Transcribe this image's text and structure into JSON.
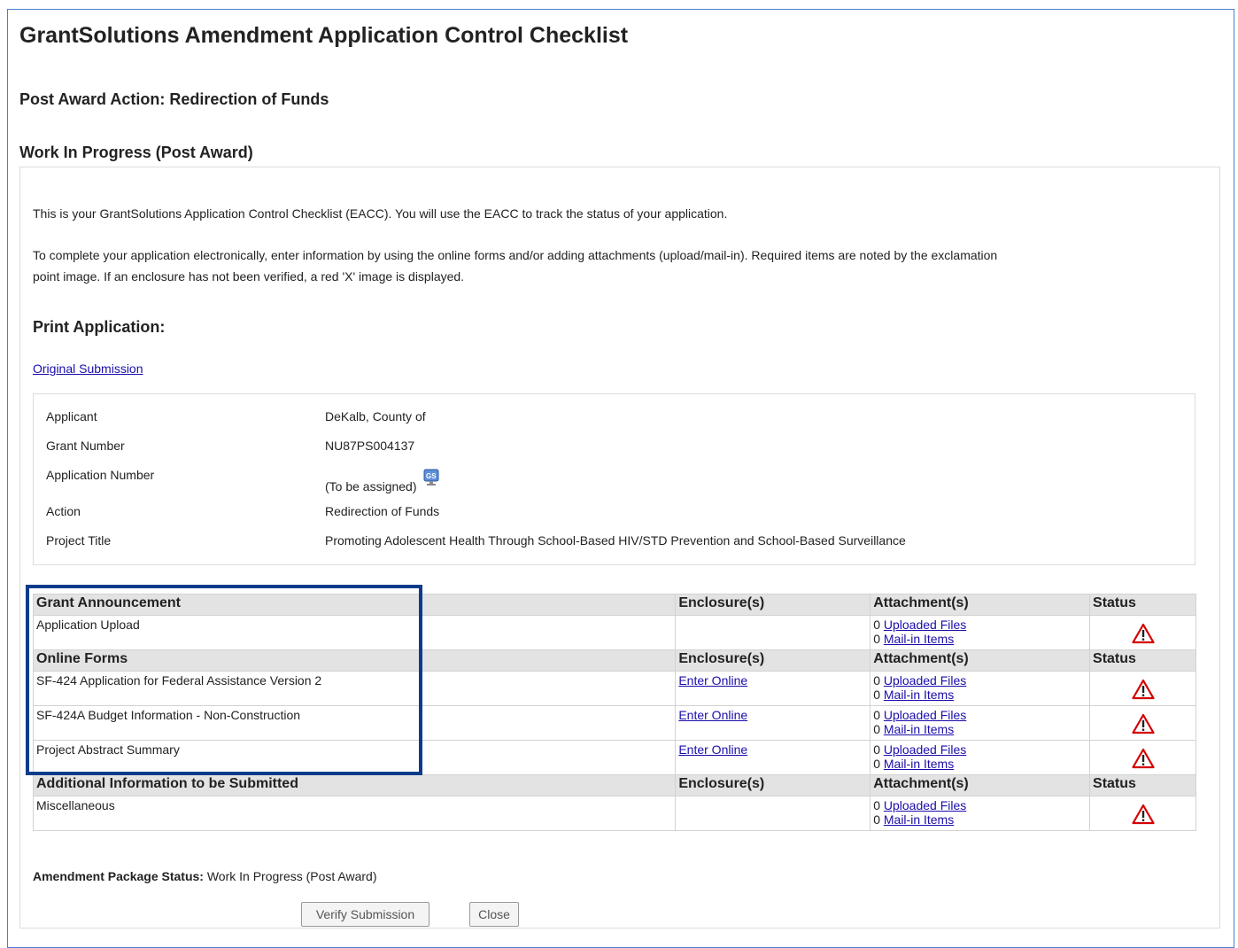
{
  "page": {
    "title": "GrantSolutions Amendment Application Control Checklist",
    "post_award_action": "Post Award Action: Redirection of Funds",
    "work_status_heading": "Work In Progress (Post Award)"
  },
  "intro": {
    "para1": "This is your GrantSolutions Application Control Checklist (EACC). You will use the EACC to track the status of your application.",
    "para2_line1": "To complete your application electronically, enter information by using the online forms and/or adding attachments (upload/mail-in).  Required items are noted by the exclamation",
    "para2_line2": "point image.  If an enclosure has not been verified, a red 'X' image is displayed."
  },
  "print": {
    "heading": "Print Application:",
    "original_submission_link": "Original Submission"
  },
  "info": {
    "applicant_label": "Applicant",
    "applicant_value": "DeKalb, County of",
    "grant_number_label": "Grant Number",
    "grant_number_value": "NU87PS004137",
    "application_number_label": "Application Number",
    "application_number_value": "(To be assigned)",
    "application_number_icon": "gs-icon",
    "action_label": "Action",
    "action_value": "Redirection of Funds",
    "project_title_label": "Project Title",
    "project_title_value": "Promoting Adolescent Health Through School-Based HIV/STD Prevention and School-Based Surveillance"
  },
  "checklist": {
    "enclosures_header": "Enclosure(s)",
    "attachments_header": "Attachment(s)",
    "status_header": "Status",
    "uploaded_label": "Uploaded Files",
    "mailin_label": "Mail-in Items",
    "status_icon": "warning-icon",
    "warning_color": "#d40000",
    "sections": [
      {
        "title": "Grant Announcement",
        "items": [
          {
            "name": "Application Upload",
            "enclosure": "",
            "uploaded_count": "0",
            "mailin_count": "0"
          }
        ]
      },
      {
        "title": "Online Forms",
        "items": [
          {
            "name": "SF-424 Application for Federal Assistance Version 2",
            "enclosure": "Enter Online",
            "uploaded_count": "0",
            "mailin_count": "0"
          },
          {
            "name": "SF-424A Budget Information - Non-Construction",
            "enclosure": "Enter Online",
            "uploaded_count": "0",
            "mailin_count": "0"
          },
          {
            "name": "Project Abstract Summary",
            "enclosure": "Enter Online",
            "uploaded_count": "0",
            "mailin_count": "0"
          }
        ]
      },
      {
        "title": "Additional Information to be Submitted",
        "items": [
          {
            "name": "Miscellaneous",
            "enclosure": "",
            "uploaded_count": "0",
            "mailin_count": "0"
          }
        ]
      }
    ]
  },
  "footer": {
    "package_status_label": "Amendment Package Status:",
    "package_status_value": "Work In Progress (Post Award)",
    "verify_button": "Verify Submission",
    "close_button": "Close"
  },
  "colors": {
    "link": "#1a0dab",
    "highlight_border": "#0b3c8c",
    "frame_border": "#4a7fd4",
    "header_bg": "#e3e3e3"
  }
}
